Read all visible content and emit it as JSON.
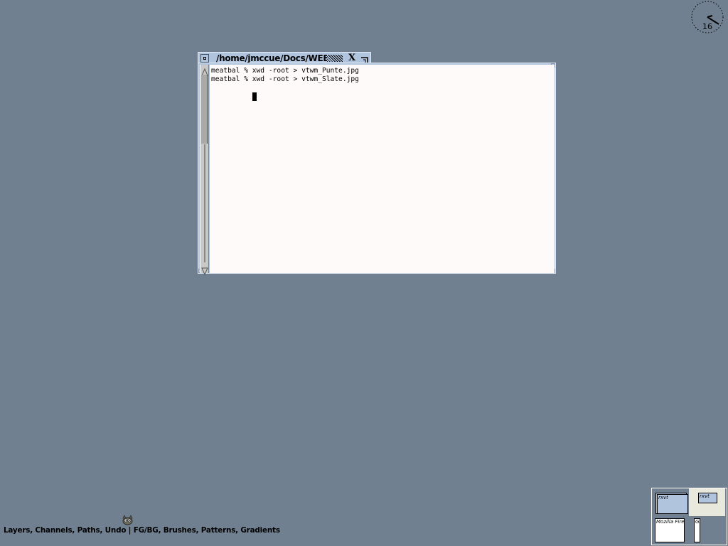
{
  "clock": {
    "minute_hand_label": "16"
  },
  "terminal": {
    "title": "/home/jmccue/Docs/WEB",
    "close_glyph": "X",
    "lines": [
      "meatbal % xwd -root > vtwm_Punte.jpg",
      "meatbal % xwd -root > vtwm_Slate.jpg"
    ]
  },
  "taskbar": {
    "gimp_label": "Layers, Channels, Paths, Undo | FG/BG, Brushes, Patterns, Gradients"
  },
  "panner": {
    "windows": [
      {
        "label": "rxvt"
      },
      {
        "label": "rxvt"
      },
      {
        "label": "Mozilla Fire"
      },
      {
        "label": "Gi"
      }
    ]
  },
  "colors": {
    "desktop": "#708090",
    "title_bar": "#b0c4de",
    "terminal_bg": "#fffafa",
    "panner_active_cell": "#e8e8dc"
  },
  "icons": [
    "clock-icon",
    "iconify-icon",
    "close-icon",
    "resize-icon",
    "scroll-up-arrow-icon",
    "scroll-down-arrow-icon",
    "gimp-wilber-icon"
  ]
}
